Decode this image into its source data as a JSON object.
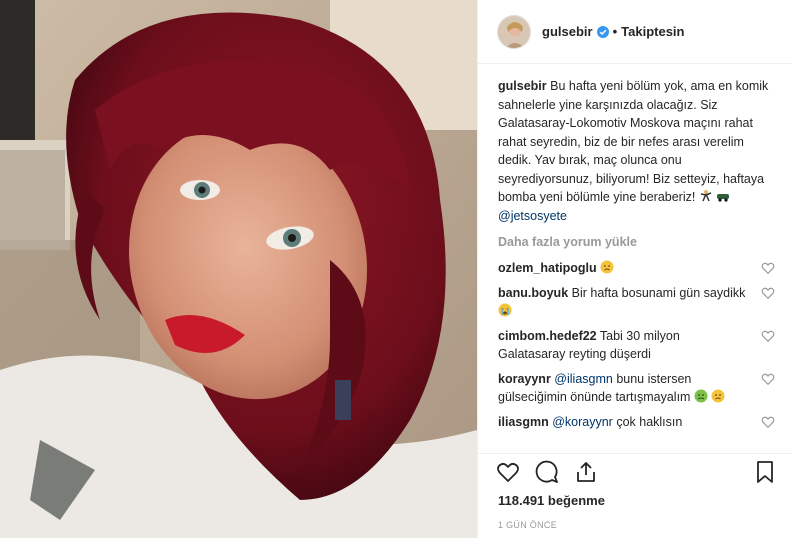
{
  "post": {
    "image_alt": "",
    "author": {
      "username": "gulsebir",
      "verified": true,
      "follow_label": "Takiptesin",
      "separator": "•"
    },
    "caption": {
      "username": "gulsebir",
      "text": "Bu hafta yeni bölüm yok, ama en komik sahnelerle yine karşınızda olacağız. Siz Galatasaray-Lokomotiv Moskova maçını rahat rahat seyredin, biz de bir nefes arası verelim dedik. Yav bırak, maç olunca onu seyrediyorsunuz, biliyorum! Biz setteyiz, haftaya bomba yeni bölümle yine beraberiz!",
      "mention": "@jetsosyete"
    },
    "load_more_label": "Daha fazla yorum yükle",
    "comments": [
      {
        "username": "ozlem_hatipoglu",
        "text": "",
        "emoji_after": "sad-face-emoji"
      },
      {
        "username": "banu.boyuk",
        "text": "Bir hafta bosunami gün saydikk",
        "emoji_after": "crying-face-emoji"
      },
      {
        "username": "cimbom.hedef22",
        "text": "Tabi 30 milyon Galatasaray reyting düşerdi",
        "emoji_after": ""
      },
      {
        "username": "korayynr",
        "mention": "@iliasgmn",
        "text": "bunu istersen gülseciğimin önünde tartışmayalım",
        "emoji_after": "nauseated-face-emoji",
        "emoji_after2": "sad-face-emoji"
      },
      {
        "username": "iliasgmn",
        "mention": "@korayynr",
        "text": "çok haklısın",
        "emoji_after": ""
      }
    ],
    "likes_label": "118.491 beğenme",
    "time_label": "1 GÜN ÖNCE"
  },
  "colors": {
    "text": "#262626",
    "muted": "#999999",
    "mention": "#003569",
    "verified": "#3897f0",
    "border": "#efefef"
  }
}
